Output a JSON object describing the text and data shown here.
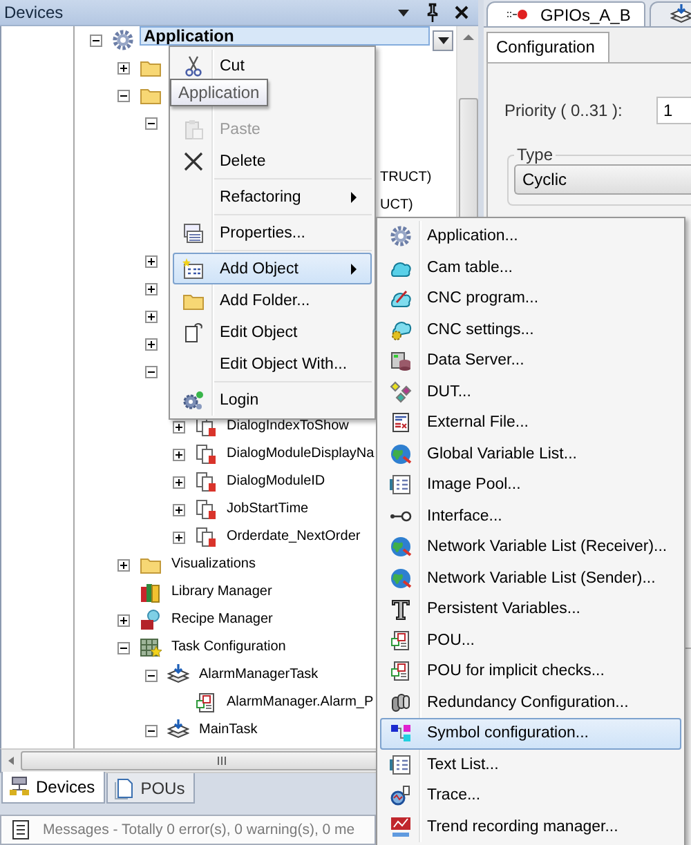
{
  "devices_panel": {
    "title": "Devices",
    "tree": {
      "label": "Application",
      "kind": "application",
      "selected": true,
      "expanded": true,
      "children": [
        {
          "kind": "folder",
          "expanded": false,
          "selected": false
        },
        {
          "kind": "folder",
          "expanded": true,
          "selected": false,
          "children": [
            {
              "expanded": true,
              "selected": false,
              "children": [
                {
                  "kind": "covered"
                },
                {
                  "kind": "covered",
                  "label": "TRUCT)",
                  "selected": false
                },
                {
                  "kind": "covered",
                  "label": "UCT)",
                  "selected": false
                },
                {
                  "kind": "covered"
                }
              ]
            },
            {
              "expanded": false,
              "selected": false
            },
            {
              "expanded": false,
              "selected": false
            },
            {
              "expanded": false,
              "selected": false
            },
            {
              "expanded": false,
              "selected": false
            },
            {
              "expanded": true,
              "selected": false,
              "children": [
                {
                  "kind": "covered"
                },
                {
                  "kind": "variable",
                  "label": "DialogIndexToShow",
                  "expanded": false,
                  "selected": false
                },
                {
                  "kind": "variable",
                  "label": "DialogModuleDisplayNa",
                  "expanded": false,
                  "selected": false
                },
                {
                  "kind": "variable",
                  "label": "DialogModuleID",
                  "expanded": false,
                  "selected": false
                },
                {
                  "kind": "variable",
                  "label": "JobStartTime",
                  "expanded": false,
                  "selected": false
                },
                {
                  "kind": "variable",
                  "label": "Orderdate_NextOrder",
                  "expanded": false,
                  "selected": false
                }
              ]
            }
          ]
        },
        {
          "kind": "folder",
          "label": "Visualizations",
          "expanded": false,
          "selected": false
        },
        {
          "kind": "library",
          "label": "Library Manager",
          "selected": false
        },
        {
          "kind": "recipe",
          "label": "Recipe Manager",
          "expanded": false,
          "selected": false
        },
        {
          "kind": "tasks",
          "label": "Task Configuration",
          "expanded": true,
          "selected": false,
          "children": [
            {
              "kind": "task",
              "label": "AlarmManagerTask",
              "expanded": true,
              "selected": false,
              "children": [
                {
                  "kind": "pou",
                  "label": "AlarmManager.Alarm_P",
                  "selected": false
                }
              ]
            },
            {
              "kind": "task",
              "label": "MainTask",
              "expanded": true,
              "selected": false
            }
          ]
        }
      ]
    },
    "tabs": [
      {
        "label": "Devices",
        "selected": true
      },
      {
        "label": "POUs",
        "selected": false
      }
    ]
  },
  "messages": {
    "text": "Messages - Totally 0 error(s), 0 warning(s), 0 me"
  },
  "editor": {
    "tabs": [
      {
        "label": "GPIOs_A_B",
        "selected": true
      },
      {
        "selected": false
      }
    ],
    "config_tabs": [
      {
        "label": "Configuration",
        "selected": true
      }
    ],
    "priority": {
      "label": "Priority ( 0..31 ):",
      "value": "1"
    },
    "type_group": {
      "label": "Type",
      "value": "Cyclic"
    }
  },
  "context_menu": {
    "items": [
      {
        "kind": "cut",
        "label": "Cut",
        "disabled": false,
        "selected": false,
        "has_submenu": false
      },
      {
        "kind": "blank"
      },
      {
        "kind": "paste",
        "label": "Paste",
        "disabled": true,
        "selected": false,
        "has_submenu": false
      },
      {
        "kind": "delete",
        "label": "Delete",
        "disabled": false,
        "selected": false,
        "has_submenu": false
      },
      {
        "kind": "separator"
      },
      {
        "kind": "none",
        "label": "Refactoring",
        "disabled": false,
        "selected": false,
        "has_submenu": true
      },
      {
        "kind": "separator"
      },
      {
        "kind": "properties",
        "label": "Properties...",
        "disabled": false,
        "selected": false,
        "has_submenu": false
      },
      {
        "kind": "separator"
      },
      {
        "kind": "add_object",
        "label": "Add Object",
        "disabled": false,
        "selected": true,
        "has_submenu": true
      },
      {
        "kind": "folder",
        "label": "Add Folder...",
        "disabled": false,
        "selected": false,
        "has_submenu": false
      },
      {
        "kind": "edit_object",
        "label": "Edit Object",
        "disabled": false,
        "selected": false,
        "has_submenu": false
      },
      {
        "kind": "none",
        "label": "Edit Object With...",
        "disabled": false,
        "selected": false,
        "has_submenu": false
      },
      {
        "kind": "separator"
      },
      {
        "kind": "login",
        "label": "Login",
        "disabled": false,
        "selected": false,
        "has_submenu": false
      }
    ]
  },
  "tooltip": {
    "text": "Application"
  },
  "submenu": {
    "items": [
      {
        "kind": "application",
        "label": "Application...",
        "selected": false
      },
      {
        "kind": "cam_table",
        "label": "Cam table...",
        "selected": false
      },
      {
        "kind": "cnc_program",
        "label": "CNC program...",
        "selected": false
      },
      {
        "kind": "cnc_settings",
        "label": "CNC settings...",
        "selected": false
      },
      {
        "kind": "data_server",
        "label": "Data Server...",
        "selected": false
      },
      {
        "kind": "dut",
        "label": "DUT...",
        "selected": false
      },
      {
        "kind": "external_file",
        "label": "External File...",
        "selected": false
      },
      {
        "kind": "gvl",
        "label": "Global Variable List...",
        "selected": false
      },
      {
        "kind": "image_pool",
        "label": "Image Pool...",
        "selected": false
      },
      {
        "kind": "interface",
        "label": "Interface...",
        "selected": false
      },
      {
        "kind": "gvl",
        "label": "Network Variable List (Receiver)...",
        "selected": false
      },
      {
        "kind": "gvl",
        "label": "Network Variable List (Sender)...",
        "selected": false
      },
      {
        "kind": "persistent",
        "label": "Persistent Variables...",
        "selected": false
      },
      {
        "kind": "pou",
        "label": "POU...",
        "selected": false
      },
      {
        "kind": "pou",
        "label": "POU for implicit checks...",
        "selected": false
      },
      {
        "kind": "redundancy",
        "label": "Redundancy Configuration...",
        "selected": false
      },
      {
        "kind": "symbol",
        "label": "Symbol configuration...",
        "selected": true
      },
      {
        "kind": "image_pool",
        "label": "Text List...",
        "selected": false
      },
      {
        "kind": "trace",
        "label": "Trace...",
        "selected": false
      },
      {
        "kind": "trend",
        "label": "Trend recording manager...",
        "selected": false
      }
    ]
  }
}
